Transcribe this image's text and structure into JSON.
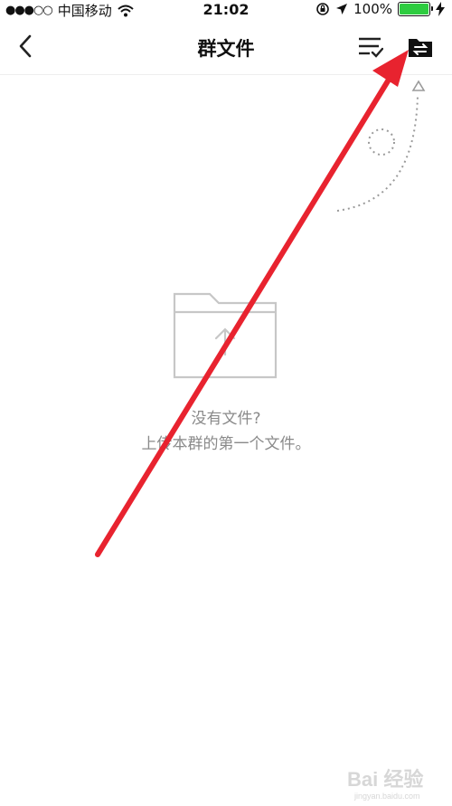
{
  "status_bar": {
    "signal": "●●●○○",
    "carrier": "中国移动",
    "time": "21:02",
    "battery_pct": "100%",
    "icons": [
      "wifi-icon",
      "rotation-lock-icon",
      "location-arrow-icon",
      "battery-icon",
      "charging-bolt-icon"
    ]
  },
  "nav": {
    "title": "群文件",
    "icons": [
      "back-chevron-icon",
      "sort-checklist-icon",
      "folder-transfer-icon"
    ]
  },
  "empty_state": {
    "line1": "没有文件?",
    "line2": "上传本群的第一个文件。",
    "icon": "upload-folder-icon"
  },
  "colors": {
    "accent_arrow": "#e8232f",
    "muted_text": "#8a8a8a",
    "battery_fill": "#2ecc40"
  },
  "watermark": {
    "text": "Bai 经验",
    "url": "jingyan.baidu.com"
  }
}
